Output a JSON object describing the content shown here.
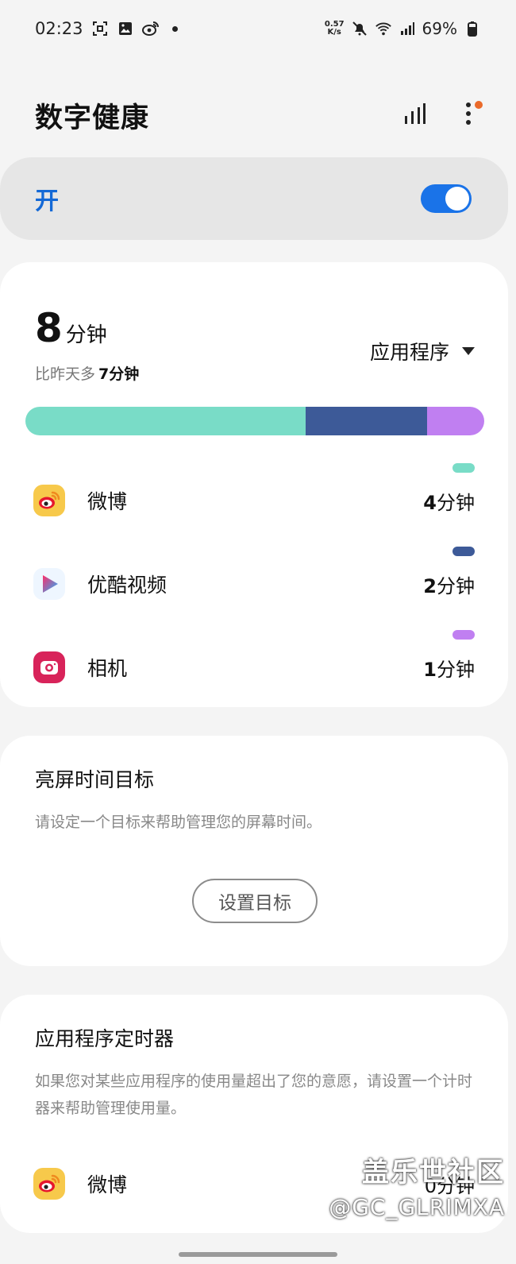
{
  "status_bar": {
    "time": "02:23",
    "net_speed_value": "0.57",
    "net_speed_unit": "K/s",
    "battery": "69%"
  },
  "header": {
    "title": "数字健康"
  },
  "master_switch": {
    "label": "开",
    "on": true
  },
  "usage": {
    "total_number": "8",
    "total_unit": "分钟",
    "compare_prefix": "比昨天多",
    "compare_value": "7分钟",
    "selector_label": "应用程序",
    "bar_segments": [
      {
        "app": "微博",
        "fraction": 0.61,
        "color": "#79dcc7"
      },
      {
        "app": "优酷视频",
        "fraction": 0.265,
        "color": "#3d5a98"
      },
      {
        "app": "相机",
        "fraction": 0.125,
        "color": "#c07ff1"
      }
    ],
    "apps": [
      {
        "name": "微博",
        "time_num": "4",
        "time_unit": "分钟",
        "color": "#79dcc7"
      },
      {
        "name": "优酷视频",
        "time_num": "2",
        "time_unit": "分钟",
        "color": "#3d5a98"
      },
      {
        "name": "相机",
        "time_num": "1",
        "time_unit": "分钟",
        "color": "#c07ff1"
      }
    ]
  },
  "screen_goal": {
    "title": "亮屏时间目标",
    "description": "请设定一个目标来帮助管理您的屏幕时间。",
    "button_label": "设置目标"
  },
  "app_timer": {
    "title": "应用程序定时器",
    "description": "如果您对某些应用程序的使用量超出了您的意愿，请设置一个计时器来帮助管理使用量。",
    "apps": [
      {
        "name": "微博",
        "time": "0分钟"
      }
    ]
  },
  "watermark": {
    "line1": "盖乐世社区",
    "line2": "@GC_GLRIMXA"
  }
}
